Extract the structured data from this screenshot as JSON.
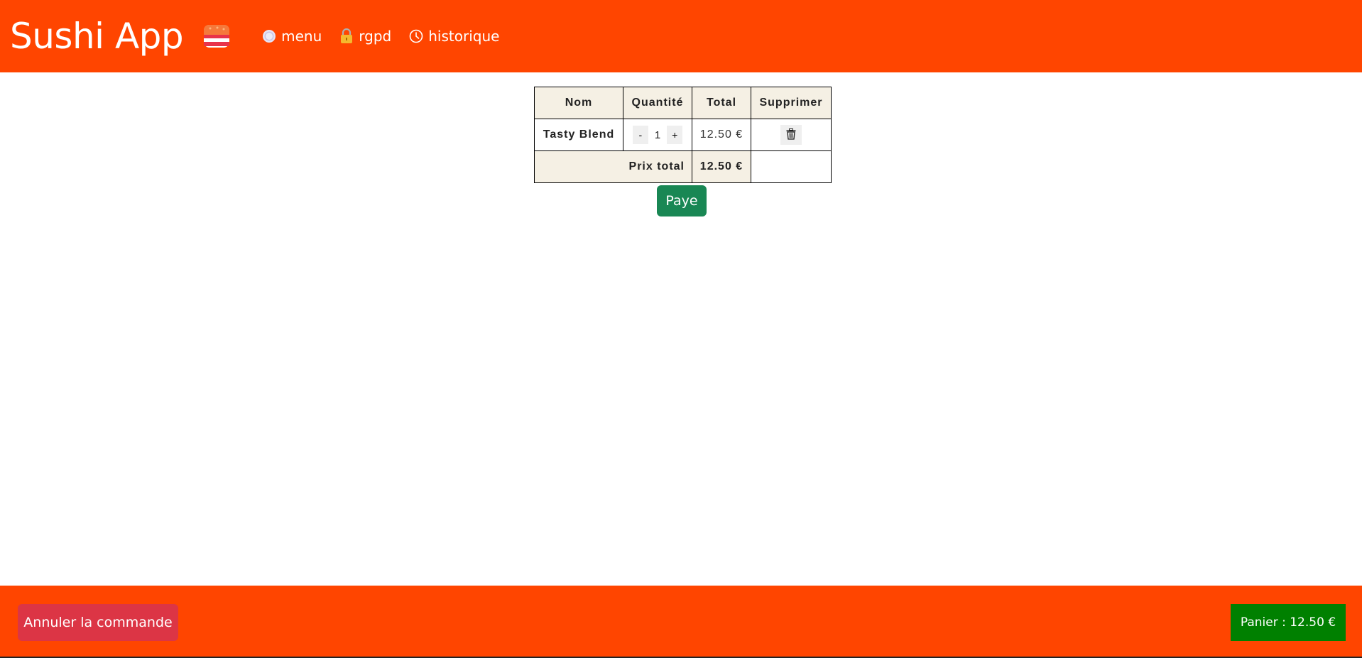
{
  "header": {
    "title": "Sushi App",
    "logo_icon": "sushi-icon",
    "nav": [
      {
        "label": "menu",
        "icon": "plate-icon"
      },
      {
        "label": "rgpd",
        "icon": "lock-icon"
      },
      {
        "label": "historique",
        "icon": "clock-icon"
      }
    ]
  },
  "cart": {
    "columns": [
      "Nom",
      "Quantité",
      "Total",
      "Supprimer"
    ],
    "items": [
      {
        "name": "Tasty Blend",
        "quantity": "1",
        "minus_label": "-",
        "plus_label": "+",
        "total": "12.50 €",
        "delete_icon": "trash-icon"
      }
    ],
    "total_label": "Prix total",
    "total_value": "12.50 €",
    "pay_label": "Paye"
  },
  "footer": {
    "cancel_label": "Annuler la commande",
    "cart_label": "Panier : 12.50 €"
  },
  "colors": {
    "header_bg": "#ff4500",
    "footer_bg": "#ff4500",
    "pay_button": "#198754",
    "cancel_button": "#dc3545",
    "cart_button": "#008000",
    "table_header_bg": "#f5f0e4"
  }
}
